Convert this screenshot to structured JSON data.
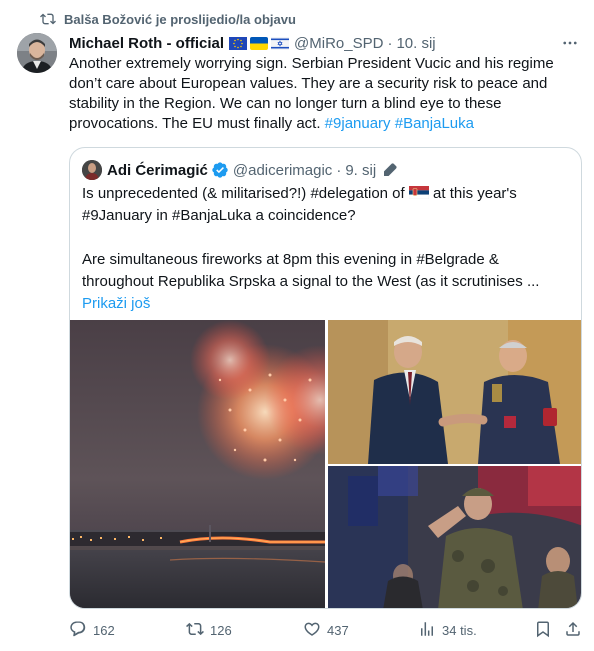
{
  "repost": {
    "text": "Balša Božović je proslijedio/la objavu",
    "icon": "repost-icon"
  },
  "tweet": {
    "author": "Michael Roth - official",
    "flags": [
      "eu-flag",
      "ukraine-flag",
      "israel-flag"
    ],
    "handle": "@MiRo_SPD",
    "dot": "·",
    "date": "10. sij",
    "text_plain": "Another extremely worrying sign. Serbian President Vucic and his regime don’t care about European values. They are a security risk to peace and stability in the Region. We can no longer turn a blind eye to these provocations. The EU must finally act.",
    "hashtags": [
      "#9january",
      "#BanjaLuka"
    ]
  },
  "quote": {
    "author": "Adi Ćerimagić",
    "handle": "@adicerimagic",
    "dot": "·",
    "date": "9. sij",
    "line1_pre": "Is unprecedented (& militarised?!) #delegation of",
    "line1_post": "at this year's #9January in #BanjaLuka a coincidence?",
    "para2": "Are simultaneous fireworks at 8pm this evening in #Belgrade & throughout Republika Srpska a signal to the West (as it scrutinises ...",
    "show_more": "Prikaži još"
  },
  "actions": {
    "replies": "162",
    "reposts": "126",
    "likes": "437",
    "views": "34 tis."
  },
  "colors": {
    "accent": "#1d9bf0",
    "muted": "#536471",
    "border": "#cfd9de"
  }
}
